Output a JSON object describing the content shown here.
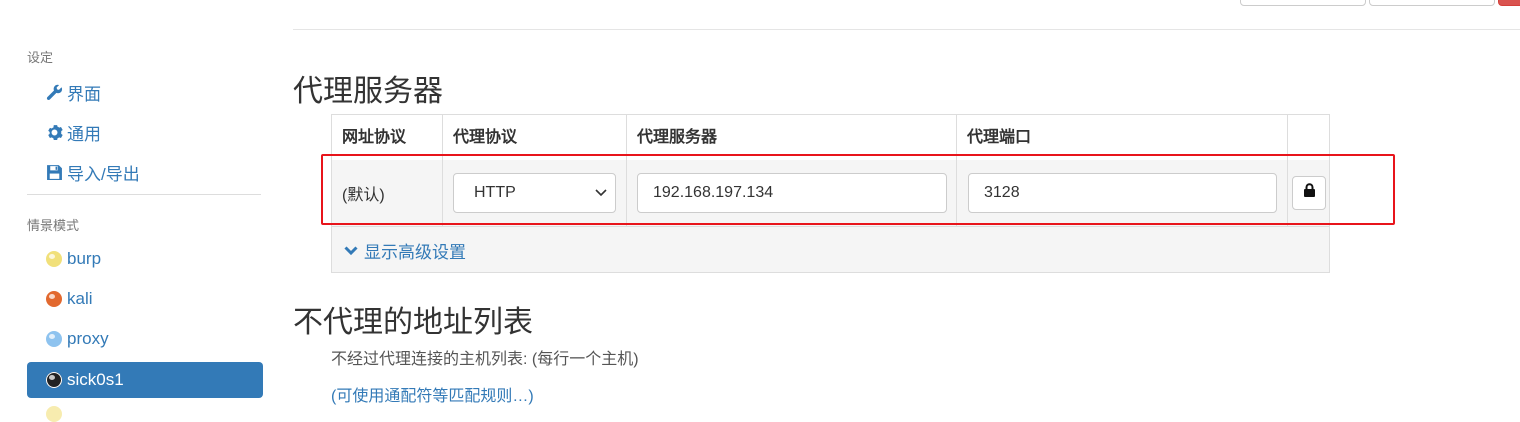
{
  "sidebar": {
    "settings_header": "设定",
    "settings_items": [
      {
        "label": "界面",
        "icon": "wrench-icon"
      },
      {
        "label": "通用",
        "icon": "gear-icon"
      },
      {
        "label": "导入/导出",
        "icon": "floppy-disk-icon"
      }
    ],
    "profiles_header": "情景模式",
    "profiles": [
      {
        "label": "burp",
        "icon": "globe-icon",
        "color": "#f1e07a"
      },
      {
        "label": "kali",
        "icon": "globe-icon",
        "color": "#e2692f"
      },
      {
        "label": "proxy",
        "icon": "globe-icon",
        "color": "#8ec3ef"
      },
      {
        "label": "sick0s1",
        "icon": "globe-icon",
        "color": "#222222",
        "active": true
      }
    ]
  },
  "main": {
    "proxy_title": "代理服务器",
    "table": {
      "headers": [
        "网址协议",
        "代理协议",
        "代理服务器",
        "代理端口"
      ],
      "row": {
        "scheme": "(默认)",
        "protocol": "HTTP",
        "server": "192.168.197.134",
        "port": "3128"
      },
      "advanced_label": "显示高级设置"
    },
    "bypass_title": "不代理的地址列表",
    "bypass_desc": "不经过代理连接的主机列表: (每行一个主机)",
    "wildcard_link": "(可使用通配符等匹配规则…)"
  },
  "colors": {
    "accent": "#337ab7",
    "highlight": "#e8141b"
  }
}
